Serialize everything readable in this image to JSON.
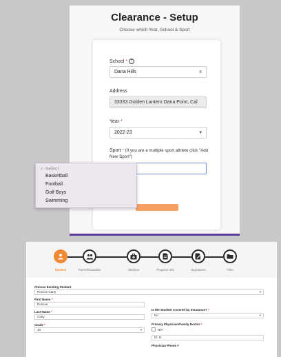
{
  "setup": {
    "title": "Clearance - Setup",
    "subtitle": "Choose which Year, School & Sport",
    "school_label": "School",
    "school_value": "Dana Hills",
    "school_clear": "x",
    "address_label": "Address",
    "address_value": "33333 Golden Lantern Dana Point, Cal",
    "year_label": "Year",
    "year_value": "2022-23",
    "sport_label": "Sport",
    "sport_note": "(If you are a multiple sport athlete click \"Add New Sport\")",
    "required_mark": "*",
    "help_glyph": "?",
    "dropdown_options": [
      "✓ Select",
      "Basketball",
      "Football",
      "Golf Boys",
      "Swimming"
    ]
  },
  "wizard": {
    "steps": [
      {
        "label": "Student",
        "icon": "user-icon",
        "active": true
      },
      {
        "label": "Parent/Guardian",
        "icon": "group-icon",
        "active": false
      },
      {
        "label": "Medical",
        "icon": "medical-bag-icon",
        "active": false
      },
      {
        "label": "Program Info",
        "icon": "document-icon",
        "active": false
      },
      {
        "label": "Signatures",
        "icon": "signature-icon",
        "active": false
      },
      {
        "label": "Files",
        "icon": "folder-icon",
        "active": false
      }
    ],
    "existing_student_label": "Choose Existing Student",
    "existing_student_value": "Roscoe Carty",
    "first_name_label": "First Name",
    "first_name_value": "Roscoe",
    "last_name_label": "Last Name",
    "last_name_value": "Carty",
    "grade_label": "Grade",
    "grade_value": "10",
    "insurance_label": "Is the Student Covered by Insurance?",
    "insurance_value": "No",
    "physician_label": "Primary Physician/Family Doctor",
    "physician_na": "N/A",
    "physician_value": "Dr. B",
    "physician_phone_label": "Physician Phone #"
  },
  "colors": {
    "accent_orange": "#f08a35",
    "purple_bar": "#5b3a9a",
    "required_red": "#e04040"
  }
}
